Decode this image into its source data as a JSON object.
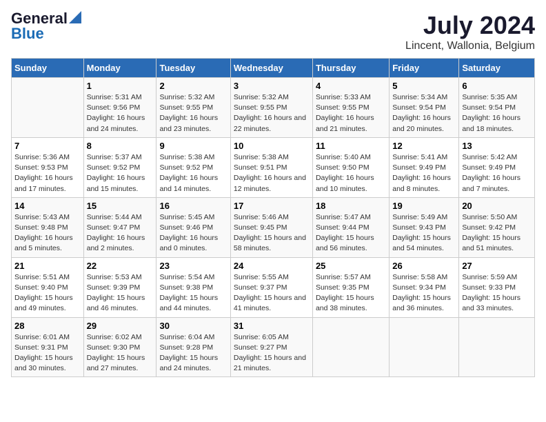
{
  "logo": {
    "general": "General",
    "blue": "Blue"
  },
  "title": "July 2024",
  "subtitle": "Lincent, Wallonia, Belgium",
  "days_header": [
    "Sunday",
    "Monday",
    "Tuesday",
    "Wednesday",
    "Thursday",
    "Friday",
    "Saturday"
  ],
  "weeks": [
    [
      {
        "day": "",
        "sunrise": "",
        "sunset": "",
        "daylight": ""
      },
      {
        "day": "1",
        "sunrise": "Sunrise: 5:31 AM",
        "sunset": "Sunset: 9:56 PM",
        "daylight": "Daylight: 16 hours and 24 minutes."
      },
      {
        "day": "2",
        "sunrise": "Sunrise: 5:32 AM",
        "sunset": "Sunset: 9:55 PM",
        "daylight": "Daylight: 16 hours and 23 minutes."
      },
      {
        "day": "3",
        "sunrise": "Sunrise: 5:32 AM",
        "sunset": "Sunset: 9:55 PM",
        "daylight": "Daylight: 16 hours and 22 minutes."
      },
      {
        "day": "4",
        "sunrise": "Sunrise: 5:33 AM",
        "sunset": "Sunset: 9:55 PM",
        "daylight": "Daylight: 16 hours and 21 minutes."
      },
      {
        "day": "5",
        "sunrise": "Sunrise: 5:34 AM",
        "sunset": "Sunset: 9:54 PM",
        "daylight": "Daylight: 16 hours and 20 minutes."
      },
      {
        "day": "6",
        "sunrise": "Sunrise: 5:35 AM",
        "sunset": "Sunset: 9:54 PM",
        "daylight": "Daylight: 16 hours and 18 minutes."
      }
    ],
    [
      {
        "day": "7",
        "sunrise": "Sunrise: 5:36 AM",
        "sunset": "Sunset: 9:53 PM",
        "daylight": "Daylight: 16 hours and 17 minutes."
      },
      {
        "day": "8",
        "sunrise": "Sunrise: 5:37 AM",
        "sunset": "Sunset: 9:52 PM",
        "daylight": "Daylight: 16 hours and 15 minutes."
      },
      {
        "day": "9",
        "sunrise": "Sunrise: 5:38 AM",
        "sunset": "Sunset: 9:52 PM",
        "daylight": "Daylight: 16 hours and 14 minutes."
      },
      {
        "day": "10",
        "sunrise": "Sunrise: 5:38 AM",
        "sunset": "Sunset: 9:51 PM",
        "daylight": "Daylight: 16 hours and 12 minutes."
      },
      {
        "day": "11",
        "sunrise": "Sunrise: 5:40 AM",
        "sunset": "Sunset: 9:50 PM",
        "daylight": "Daylight: 16 hours and 10 minutes."
      },
      {
        "day": "12",
        "sunrise": "Sunrise: 5:41 AM",
        "sunset": "Sunset: 9:49 PM",
        "daylight": "Daylight: 16 hours and 8 minutes."
      },
      {
        "day": "13",
        "sunrise": "Sunrise: 5:42 AM",
        "sunset": "Sunset: 9:49 PM",
        "daylight": "Daylight: 16 hours and 7 minutes."
      }
    ],
    [
      {
        "day": "14",
        "sunrise": "Sunrise: 5:43 AM",
        "sunset": "Sunset: 9:48 PM",
        "daylight": "Daylight: 16 hours and 5 minutes."
      },
      {
        "day": "15",
        "sunrise": "Sunrise: 5:44 AM",
        "sunset": "Sunset: 9:47 PM",
        "daylight": "Daylight: 16 hours and 2 minutes."
      },
      {
        "day": "16",
        "sunrise": "Sunrise: 5:45 AM",
        "sunset": "Sunset: 9:46 PM",
        "daylight": "Daylight: 16 hours and 0 minutes."
      },
      {
        "day": "17",
        "sunrise": "Sunrise: 5:46 AM",
        "sunset": "Sunset: 9:45 PM",
        "daylight": "Daylight: 15 hours and 58 minutes."
      },
      {
        "day": "18",
        "sunrise": "Sunrise: 5:47 AM",
        "sunset": "Sunset: 9:44 PM",
        "daylight": "Daylight: 15 hours and 56 minutes."
      },
      {
        "day": "19",
        "sunrise": "Sunrise: 5:49 AM",
        "sunset": "Sunset: 9:43 PM",
        "daylight": "Daylight: 15 hours and 54 minutes."
      },
      {
        "day": "20",
        "sunrise": "Sunrise: 5:50 AM",
        "sunset": "Sunset: 9:42 PM",
        "daylight": "Daylight: 15 hours and 51 minutes."
      }
    ],
    [
      {
        "day": "21",
        "sunrise": "Sunrise: 5:51 AM",
        "sunset": "Sunset: 9:40 PM",
        "daylight": "Daylight: 15 hours and 49 minutes."
      },
      {
        "day": "22",
        "sunrise": "Sunrise: 5:53 AM",
        "sunset": "Sunset: 9:39 PM",
        "daylight": "Daylight: 15 hours and 46 minutes."
      },
      {
        "day": "23",
        "sunrise": "Sunrise: 5:54 AM",
        "sunset": "Sunset: 9:38 PM",
        "daylight": "Daylight: 15 hours and 44 minutes."
      },
      {
        "day": "24",
        "sunrise": "Sunrise: 5:55 AM",
        "sunset": "Sunset: 9:37 PM",
        "daylight": "Daylight: 15 hours and 41 minutes."
      },
      {
        "day": "25",
        "sunrise": "Sunrise: 5:57 AM",
        "sunset": "Sunset: 9:35 PM",
        "daylight": "Daylight: 15 hours and 38 minutes."
      },
      {
        "day": "26",
        "sunrise": "Sunrise: 5:58 AM",
        "sunset": "Sunset: 9:34 PM",
        "daylight": "Daylight: 15 hours and 36 minutes."
      },
      {
        "day": "27",
        "sunrise": "Sunrise: 5:59 AM",
        "sunset": "Sunset: 9:33 PM",
        "daylight": "Daylight: 15 hours and 33 minutes."
      }
    ],
    [
      {
        "day": "28",
        "sunrise": "Sunrise: 6:01 AM",
        "sunset": "Sunset: 9:31 PM",
        "daylight": "Daylight: 15 hours and 30 minutes."
      },
      {
        "day": "29",
        "sunrise": "Sunrise: 6:02 AM",
        "sunset": "Sunset: 9:30 PM",
        "daylight": "Daylight: 15 hours and 27 minutes."
      },
      {
        "day": "30",
        "sunrise": "Sunrise: 6:04 AM",
        "sunset": "Sunset: 9:28 PM",
        "daylight": "Daylight: 15 hours and 24 minutes."
      },
      {
        "day": "31",
        "sunrise": "Sunrise: 6:05 AM",
        "sunset": "Sunset: 9:27 PM",
        "daylight": "Daylight: 15 hours and 21 minutes."
      },
      {
        "day": "",
        "sunrise": "",
        "sunset": "",
        "daylight": ""
      },
      {
        "day": "",
        "sunrise": "",
        "sunset": "",
        "daylight": ""
      },
      {
        "day": "",
        "sunrise": "",
        "sunset": "",
        "daylight": ""
      }
    ]
  ]
}
